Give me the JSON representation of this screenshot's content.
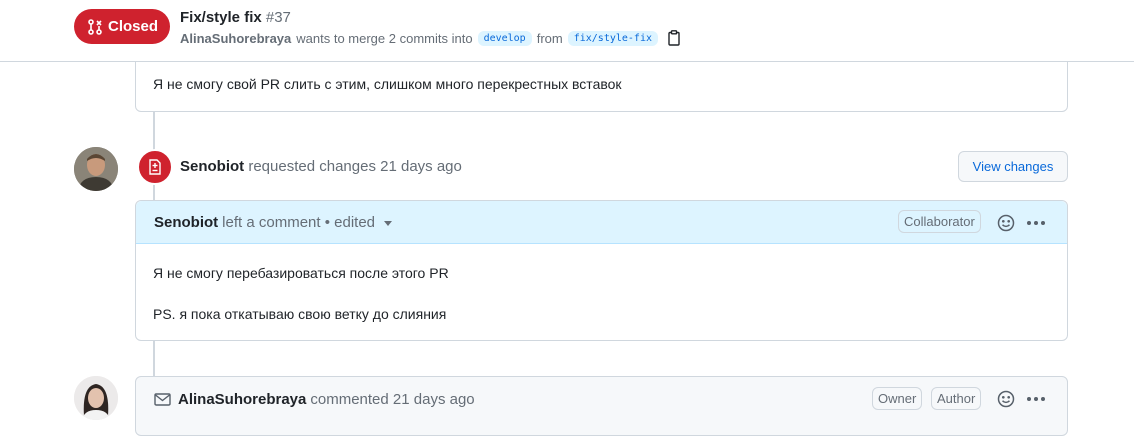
{
  "header": {
    "state": "Closed",
    "title": "Fix/style fix",
    "number": "#37",
    "author": "AlinaSuhorebraya",
    "merge_text": "wants to merge 2 commits into",
    "base_branch": "develop",
    "from_text": "from",
    "head_branch": "fix/style-fix"
  },
  "comment1": {
    "body": "Я не смогу свой PR слить с этим, слишком много перекрестных вставок"
  },
  "review": {
    "author": "Senobiot",
    "action": "requested changes",
    "time": "21 days ago",
    "view_changes_label": "View changes"
  },
  "comment2": {
    "author": "Senobiot",
    "meta": "left a comment • edited",
    "role": "Collaborator",
    "line1": "Я не смогу перебазироваться после этого PR",
    "line2": "PS. я пока откатываю свою ветку до слияния"
  },
  "comment3": {
    "author": "AlinaSuhorebraya",
    "meta": "commented 21 days ago",
    "badge_owner": "Owner",
    "badge_author": "Author"
  },
  "colors": {
    "closed_red": "#cf222e",
    "link_blue": "#0969da",
    "comment_header_blue": "#ddf4ff"
  },
  "icons": [
    "git-pull-request-closed-icon",
    "copy-icon",
    "file-diff-icon",
    "triangle-down-icon",
    "smiley-icon",
    "kebab-horizontal-icon",
    "mail-icon"
  ]
}
